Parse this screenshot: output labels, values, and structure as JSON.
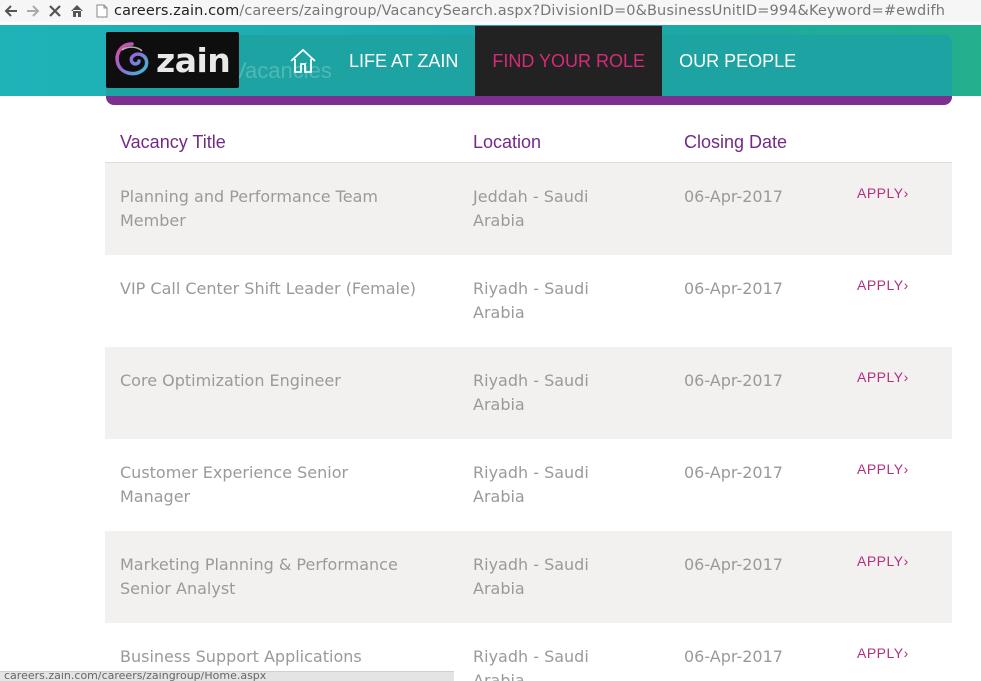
{
  "browser": {
    "url_host": "careers.zain.com",
    "url_path": "/careers/zaingroup/VacancySearch.aspx?DivisionID=0&BusinessUnitID=994&Keyword=#ewdifh",
    "icons": [
      "back-arrow-icon",
      "forward-arrow-icon",
      "stop-icon",
      "home-icon",
      "page-icon"
    ]
  },
  "site": {
    "logo_text": "zain",
    "ghost_title": "Vacancies",
    "colors": {
      "teal": "#1fb3b8",
      "purple": "#722a86",
      "magenta": "#d62b78",
      "row_shade": "#f2f1ef"
    }
  },
  "nav": {
    "items": [
      {
        "label": "LIFE AT ZAIN"
      },
      {
        "label": "FIND YOUR ROLE",
        "active": true
      },
      {
        "label": "OUR PEOPLE"
      }
    ]
  },
  "table": {
    "headers": [
      "Vacancy Title",
      "Location",
      "Closing Date"
    ],
    "rows": [
      {
        "title": "Planning and Performance Team Member",
        "location": "Jeddah - Saudi Arabia",
        "date": "06-Apr-2017",
        "apply": "APPLY›"
      },
      {
        "title": "VIP Call Center Shift Leader (Female)",
        "location": "Riyadh - Saudi Arabia",
        "date": "06-Apr-2017",
        "apply": "APPLY›"
      },
      {
        "title": "Core Optimization Engineer",
        "location": "Riyadh - Saudi Arabia",
        "date": "06-Apr-2017",
        "apply": "APPLY›"
      },
      {
        "title": "Customer Experience Senior Manager",
        "location": "Riyadh - Saudi Arabia",
        "date": "06-Apr-2017",
        "apply": "APPLY›"
      },
      {
        "title": "Marketing Planning & Performance Senior Analyst",
        "location": "Riyadh - Saudi Arabia",
        "date": "06-Apr-2017",
        "apply": "APPLY›"
      },
      {
        "title": "Business Support Applications",
        "location": "Riyadh - Saudi Arabia",
        "date": "06-Apr-2017",
        "apply": "APPLY›"
      }
    ]
  },
  "status": {
    "text": "careers.zain.com/careers/zaingroup/Home.aspx"
  }
}
